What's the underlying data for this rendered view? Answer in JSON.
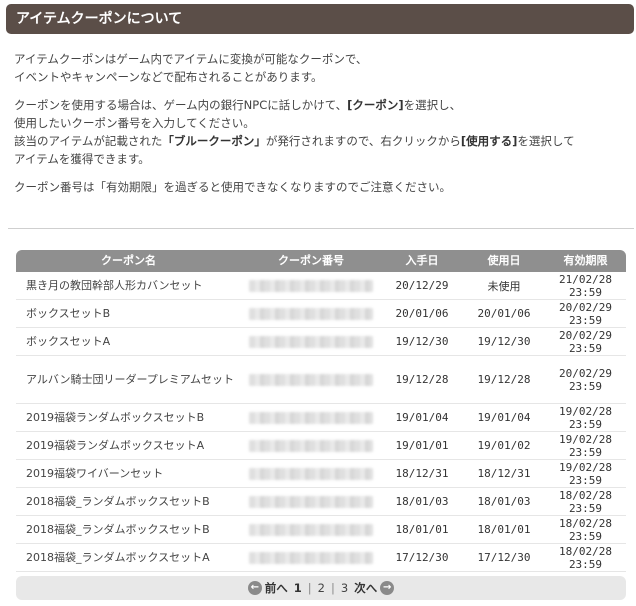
{
  "header": {
    "title": "アイテムクーポンについて"
  },
  "description": {
    "p1_line1": "アイテムクーポンはゲーム内でアイテムに変換が可能なクーポンで、",
    "p1_line2": "イベントやキャンペーンなどで配布されることがあります。",
    "p2_line1_a": "クーポンを使用する場合は、ゲーム内の銀行NPCに話しかけて、",
    "p2_line1_b": "[クーポン]",
    "p2_line1_c": "を選択し、",
    "p2_line2": "使用したいクーポン番号を入力してください。",
    "p2_line3_a": "該当のアイテムが記載された",
    "p2_line3_b": "「ブルークーポン」",
    "p2_line3_c": "が発行されますので、右クリックから",
    "p2_line3_d": "[使用する]",
    "p2_line3_e": "を選択して",
    "p2_line4": "アイテムを獲得できます。",
    "p3": "クーポン番号は「有効期限」を過ぎると使用できなくなりますのでご注意ください。"
  },
  "table": {
    "headers": [
      "クーポン名",
      "クーポン番号",
      "入手日",
      "使用日",
      "有効期限"
    ],
    "rows": [
      {
        "name": "黒き月の教団幹部人形カバンセット",
        "acquired": "20/12/29",
        "used": "未使用",
        "expiry": "21/02/28 23:59"
      },
      {
        "name": "ボックスセットB",
        "acquired": "20/01/06",
        "used": "20/01/06",
        "expiry": "20/02/29 23:59"
      },
      {
        "name": "ボックスセットA",
        "acquired": "19/12/30",
        "used": "19/12/30",
        "expiry": "20/02/29 23:59"
      },
      {
        "name": "アルバン騎士団リーダープレミアムセット",
        "acquired": "19/12/28",
        "used": "19/12/28",
        "expiry": "20/02/29 23:59"
      },
      {
        "name": "2019福袋ランダムボックスセットB",
        "acquired": "19/01/04",
        "used": "19/01/04",
        "expiry": "19/02/28 23:59"
      },
      {
        "name": "2019福袋ランダムボックスセットA",
        "acquired": "19/01/01",
        "used": "19/01/02",
        "expiry": "19/02/28 23:59"
      },
      {
        "name": "2019福袋ワイバーンセット",
        "acquired": "18/12/31",
        "used": "18/12/31",
        "expiry": "19/02/28 23:59"
      },
      {
        "name": "2018福袋_ランダムボックスセットB",
        "acquired": "18/01/03",
        "used": "18/01/03",
        "expiry": "18/02/28 23:59"
      },
      {
        "name": "2018福袋_ランダムボックスセットB",
        "acquired": "18/01/01",
        "used": "18/01/01",
        "expiry": "18/02/28 23:59"
      },
      {
        "name": "2018福袋_ランダムボックスセットA",
        "acquired": "17/12/30",
        "used": "17/12/30",
        "expiry": "18/02/28 23:59"
      }
    ]
  },
  "pager": {
    "prev_label": "前へ",
    "next_label": "次へ",
    "pages": [
      "1",
      "2",
      "3"
    ],
    "separator": "|",
    "current": "1",
    "prev_icon": "arrow-left-icon",
    "next_icon": "arrow-right-icon"
  },
  "colors": {
    "header_bg": "#5b4e48",
    "table_head_bg": "#8f8f8f",
    "pager_bg": "#e8e8e8"
  }
}
